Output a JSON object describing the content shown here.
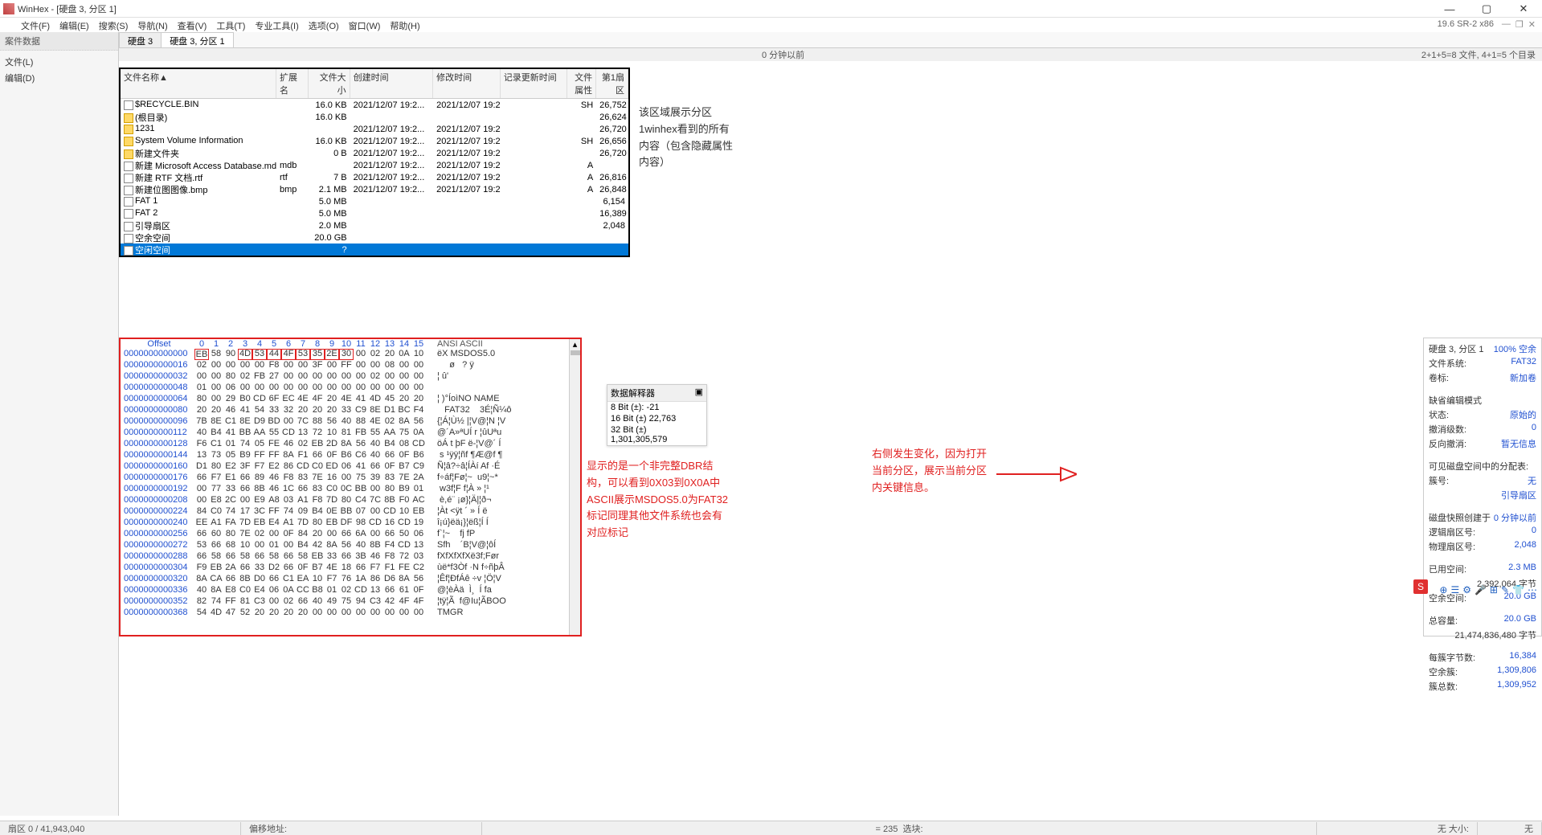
{
  "title": "WinHex - [硬盘 3, 分区 1]",
  "version": "19.6 SR-2 x86",
  "menus": [
    "文件(F)",
    "编辑(E)",
    "搜索(S)",
    "导航(N)",
    "查看(V)",
    "工具(T)",
    "专业工具(I)",
    "选项(O)",
    "窗口(W)",
    "帮助(H)"
  ],
  "left_panel": {
    "header": "案件数据",
    "items": [
      "文件(L)",
      "编辑(D)"
    ]
  },
  "tabs": [
    "硬盘 3",
    "硬盘 3, 分区 1"
  ],
  "info_time": "0 分钟以前",
  "info_count": "2+1+5=8 文件, 4+1=5 个目录",
  "file_headers": [
    "文件名称",
    "扩展名",
    "文件大小",
    "创建时间",
    "修改时间",
    "记录更新时间",
    "文件属性",
    "第1扇区"
  ],
  "files": [
    {
      "icon": "file",
      "name": "$RECYCLE.BIN",
      "ext": "",
      "size": "16.0 KB",
      "ctime": "2021/12/07  19:2...",
      "mtime": "2021/12/07  19:2...",
      "utime": "",
      "attr": "SH",
      "sect": "26,752"
    },
    {
      "icon": "folder",
      "name": "(根目录)",
      "ext": "",
      "size": "16.0 KB",
      "ctime": "",
      "mtime": "",
      "utime": "",
      "attr": "",
      "sect": "26,624"
    },
    {
      "icon": "folder",
      "name": "1231",
      "ext": "",
      "size": "",
      "ctime": "2021/12/07  19:2...",
      "mtime": "2021/12/07  19:2...",
      "utime": "",
      "attr": "",
      "sect": "26,720"
    },
    {
      "icon": "folder",
      "name": "System Volume Information",
      "ext": "",
      "size": "16.0 KB",
      "ctime": "2021/12/07  19:2...",
      "mtime": "2021/12/07  19:2...",
      "utime": "",
      "attr": "SH",
      "sect": "26,656"
    },
    {
      "icon": "folder",
      "name": "新建文件夹",
      "ext": "",
      "size": "0 B",
      "ctime": "2021/12/07  19:2...",
      "mtime": "2021/12/07  19:2...",
      "utime": "",
      "attr": "",
      "sect": "26,720"
    },
    {
      "icon": "file",
      "name": "新建 Microsoft Access Database.mdb",
      "ext": "mdb",
      "size": "",
      "ctime": "2021/12/07  19:2...",
      "mtime": "2021/12/07  19:2...",
      "utime": "",
      "attr": "A",
      "sect": ""
    },
    {
      "icon": "file",
      "name": "新建 RTF 文档.rtf",
      "ext": "rtf",
      "size": "7 B",
      "ctime": "2021/12/07  19:2...",
      "mtime": "2021/12/07  19:2...",
      "utime": "",
      "attr": "A",
      "sect": "26,816"
    },
    {
      "icon": "file",
      "name": "新建位图图像.bmp",
      "ext": "bmp",
      "size": "2.1 MB",
      "ctime": "2021/12/07  19:2...",
      "mtime": "2021/12/07  19:2...",
      "utime": "",
      "attr": "A",
      "sect": "26,848"
    },
    {
      "icon": "file",
      "name": "FAT 1",
      "ext": "",
      "size": "5.0 MB",
      "ctime": "",
      "mtime": "",
      "utime": "",
      "attr": "",
      "sect": "6,154"
    },
    {
      "icon": "file",
      "name": "FAT 2",
      "ext": "",
      "size": "5.0 MB",
      "ctime": "",
      "mtime": "",
      "utime": "",
      "attr": "",
      "sect": "16,389"
    },
    {
      "icon": "file",
      "name": "引导扇区",
      "ext": "",
      "size": "2.0 MB",
      "ctime": "",
      "mtime": "",
      "utime": "",
      "attr": "",
      "sect": "2,048"
    },
    {
      "icon": "file",
      "name": "空余空间",
      "ext": "",
      "size": "20.0 GB",
      "ctime": "",
      "mtime": "",
      "utime": "",
      "attr": "",
      "sect": ""
    },
    {
      "icon": "file",
      "name": "空闲空间",
      "ext": "",
      "size": "?",
      "ctime": "",
      "mtime": "",
      "utime": "",
      "attr": "",
      "sect": "",
      "sel": true
    }
  ],
  "annot1": "该区域展示分区1winhex看到的所有内容（包含隐藏属性内容）",
  "hex": {
    "head_offset": "Offset",
    "cols": [
      "0",
      "1",
      "2",
      "3",
      "4",
      "5",
      "6",
      "7",
      "8",
      "9",
      "10",
      "11",
      "12",
      "13",
      "14",
      "15"
    ],
    "ascii_label": "ANSI ASCII",
    "rows": [
      {
        "o": "0000000000000",
        "h": [
          "EB",
          "58",
          "90",
          "4D",
          "53",
          "44",
          "4F",
          "53",
          "35",
          "2E",
          "30",
          "00",
          "02",
          "20",
          "0A",
          "10"
        ],
        "a": "ëX MSDOS5.0"
      },
      {
        "o": "0000000000016",
        "h": [
          "02",
          "00",
          "00",
          "00",
          "00",
          "F8",
          "00",
          "00",
          "3F",
          "00",
          "FF",
          "00",
          "00",
          "08",
          "00",
          "00"
        ],
        "a": "     ø   ? ÿ"
      },
      {
        "o": "0000000000032",
        "h": [
          "00",
          "00",
          "80",
          "02",
          "FB",
          "27",
          "00",
          "00",
          "00",
          "00",
          "00",
          "00",
          "02",
          "00",
          "00",
          "00"
        ],
        "a": "¦ û'"
      },
      {
        "o": "0000000000048",
        "h": [
          "01",
          "00",
          "06",
          "00",
          "00",
          "00",
          "00",
          "00",
          "00",
          "00",
          "00",
          "00",
          "00",
          "00",
          "00",
          "00"
        ],
        "a": ""
      },
      {
        "o": "0000000000064",
        "h": [
          "80",
          "00",
          "29",
          "B0",
          "CD",
          "6F",
          "EC",
          "4E",
          "4F",
          "20",
          "4E",
          "41",
          "4D",
          "45",
          "20",
          "20"
        ],
        "a": "¦ )°ÍoìNO NAME"
      },
      {
        "o": "0000000000080",
        "h": [
          "20",
          "20",
          "46",
          "41",
          "54",
          "33",
          "32",
          "20",
          "20",
          "20",
          "33",
          "C9",
          "8E",
          "D1",
          "BC",
          "F4"
        ],
        "a": "   FAT32    3É¦Ñ¼ô"
      },
      {
        "o": "0000000000096",
        "h": [
          "7B",
          "8E",
          "C1",
          "8E",
          "D9",
          "BD",
          "00",
          "7C",
          "88",
          "56",
          "40",
          "88",
          "4E",
          "02",
          "8A",
          "56"
        ],
        "a": "{¦Á¦Ù½ |¦V@¦N ¦V"
      },
      {
        "o": "0000000000112",
        "h": [
          "40",
          "B4",
          "41",
          "BB",
          "AA",
          "55",
          "CD",
          "13",
          "72",
          "10",
          "81",
          "FB",
          "55",
          "AA",
          "75",
          "0A"
        ],
        "a": "@´A»ªUÍ r ¦ûUªu"
      },
      {
        "o": "0000000000128",
        "h": [
          "F6",
          "C1",
          "01",
          "74",
          "05",
          "FE",
          "46",
          "02",
          "EB",
          "2D",
          "8A",
          "56",
          "40",
          "B4",
          "08",
          "CD"
        ],
        "a": "öÁ t þF ë-¦V@´ Í"
      },
      {
        "o": "0000000000144",
        "h": [
          "13",
          "73",
          "05",
          "B9",
          "FF",
          "FF",
          "8A",
          "F1",
          "66",
          "0F",
          "B6",
          "C6",
          "40",
          "66",
          "0F",
          "B6"
        ],
        "a": " s ¹ÿÿ¦ñf ¶Æ@f ¶"
      },
      {
        "o": "0000000000160",
        "h": [
          "D1",
          "80",
          "E2",
          "3F",
          "F7",
          "E2",
          "86",
          "CD",
          "C0",
          "ED",
          "06",
          "41",
          "66",
          "0F",
          "B7",
          "C9"
        ],
        "a": "Ñ¦â?÷â¦ÍÀí Af ·É"
      },
      {
        "o": "0000000000176",
        "h": [
          "66",
          "F7",
          "E1",
          "66",
          "89",
          "46",
          "F8",
          "83",
          "7E",
          "16",
          "00",
          "75",
          "39",
          "83",
          "7E",
          "2A"
        ],
        "a": "f÷áf¦Fø¦~  u9¦~*"
      },
      {
        "o": "0000000000192",
        "h": [
          "00",
          "77",
          "33",
          "66",
          "8B",
          "46",
          "1C",
          "66",
          "83",
          "C0",
          "0C",
          "BB",
          "00",
          "80",
          "B9",
          "01"
        ],
        "a": " w3f¦F f¦À » ¦¹"
      },
      {
        "o": "0000000000208",
        "h": [
          "00",
          "E8",
          "2C",
          "00",
          "E9",
          "A8",
          "03",
          "A1",
          "F8",
          "7D",
          "80",
          "C4",
          "7C",
          "8B",
          "F0",
          "AC"
        ],
        "a": " è,é¨ ¡ø}¦Ä|¦ð¬"
      },
      {
        "o": "0000000000224",
        "h": [
          "84",
          "C0",
          "74",
          "17",
          "3C",
          "FF",
          "74",
          "09",
          "B4",
          "0E",
          "BB",
          "07",
          "00",
          "CD",
          "10",
          "EB"
        ],
        "a": "¦Àt <ÿt ´ » Í ë"
      },
      {
        "o": "0000000000240",
        "h": [
          "EE",
          "A1",
          "FA",
          "7D",
          "EB",
          "E4",
          "A1",
          "7D",
          "80",
          "EB",
          "DF",
          "98",
          "CD",
          "16",
          "CD",
          "19"
        ],
        "a": "î¡ú}ëä¡}¦ëß¦Í Í"
      },
      {
        "o": "0000000000256",
        "h": [
          "66",
          "60",
          "80",
          "7E",
          "02",
          "00",
          "0F",
          "84",
          "20",
          "00",
          "66",
          "6A",
          "00",
          "66",
          "50",
          "06"
        ],
        "a": "f`¦~    fj fP"
      },
      {
        "o": "0000000000272",
        "h": [
          "53",
          "66",
          "68",
          "10",
          "00",
          "01",
          "00",
          "B4",
          "42",
          "8A",
          "56",
          "40",
          "8B",
          "F4",
          "CD",
          "13"
        ],
        "a": "Sfh    ´B¦V@¦ôÍ"
      },
      {
        "o": "0000000000288",
        "h": [
          "66",
          "58",
          "66",
          "58",
          "66",
          "58",
          "66",
          "58",
          "EB",
          "33",
          "66",
          "3B",
          "46",
          "F8",
          "72",
          "03"
        ],
        "a": "fXfXfXfXë3f;Før"
      },
      {
        "o": "0000000000304",
        "h": [
          "F9",
          "EB",
          "2A",
          "66",
          "33",
          "D2",
          "66",
          "0F",
          "B7",
          "4E",
          "18",
          "66",
          "F7",
          "F1",
          "FE",
          "C2"
        ],
        "a": "ùë*f3Òf ·N f÷ñþÂ"
      },
      {
        "o": "0000000000320",
        "h": [
          "8A",
          "CA",
          "66",
          "8B",
          "D0",
          "66",
          "C1",
          "EA",
          "10",
          "F7",
          "76",
          "1A",
          "86",
          "D6",
          "8A",
          "56"
        ],
        "a": "¦Êf¦ÐfÁê ÷v ¦Ö¦V"
      },
      {
        "o": "0000000000336",
        "h": [
          "40",
          "8A",
          "E8",
          "C0",
          "E4",
          "06",
          "0A",
          "CC",
          "B8",
          "01",
          "02",
          "CD",
          "13",
          "66",
          "61",
          "0F"
        ],
        "a": "@¦èÀä  Ì¸  Í fa"
      },
      {
        "o": "0000000000352",
        "h": [
          "82",
          "74",
          "FF",
          "81",
          "C3",
          "00",
          "02",
          "66",
          "40",
          "49",
          "75",
          "94",
          "C3",
          "42",
          "4F",
          "4F"
        ],
        "a": "¦tÿ¦Ã  f@Iu¦ÃBOO"
      },
      {
        "o": "0000000000368",
        "h": [
          "54",
          "4D",
          "47",
          "52",
          "20",
          "20",
          "20",
          "20",
          "00",
          "00",
          "00",
          "00",
          "00",
          "00",
          "00",
          "00"
        ],
        "a": "TMGR"
      }
    ]
  },
  "interpreter": {
    "title": "数据解释器",
    "rows": [
      "8 Bit (±): -21",
      "16 Bit (±) 22,763",
      "32 Bit (±) 1,301,305,579"
    ]
  },
  "annot2": "显示的是一个非完整DBR结构，可以看到0X03到0X0A中ASCII展示MSDOS5.0为FAT32标记同理其他文件系统也会有对应标记",
  "annot3": "右侧发生变化，因为打开当前分区，展示当前分区内关键信息。",
  "right": {
    "r1": [
      "硬盘 3, 分区 1",
      "100% 空余"
    ],
    "r2": [
      "文件系统:",
      "FAT32"
    ],
    "r3": [
      "卷标:",
      "新加卷"
    ],
    "r4": [
      "缺省编辑模式",
      ""
    ],
    "r5": [
      "状态:",
      "原始的"
    ],
    "r6": [
      "撤消级数:",
      "0"
    ],
    "r7": [
      "反向撤消:",
      "暂无信息"
    ],
    "r8": [
      "可见磁盘空间中的分配表:",
      ""
    ],
    "r9": [
      "簇号:",
      "无"
    ],
    "r10": [
      "",
      "引导扇区"
    ],
    "r11": [
      "磁盘快照创建于",
      "0 分钟以前"
    ],
    "r12": [
      "逻辑扇区号:",
      "0"
    ],
    "r13": [
      "物理扇区号:",
      "2,048"
    ],
    "r14": [
      "已用空间:",
      "2.3 MB"
    ],
    "r15": [
      "",
      "2,392,064 字节"
    ],
    "r16": [
      "空余空间:",
      "20.0 GB"
    ],
    "r17": [
      "总容量:",
      "20.0 GB"
    ],
    "r18": [
      "",
      "21,474,836,480 字节"
    ],
    "r19": [
      "每簇字节数:",
      "16,384"
    ],
    "r20": [
      "空余簇:",
      "1,309,806"
    ],
    "r21": [
      "簇总数:",
      "1,309,952"
    ]
  },
  "status": {
    "s1": "扇区 0 / 41,943,040",
    "s2": "偏移地址:",
    "s3": "= 235",
    "s4": "选块:",
    "s5": "无 大小:",
    "s6": "无"
  },
  "ime": "S"
}
